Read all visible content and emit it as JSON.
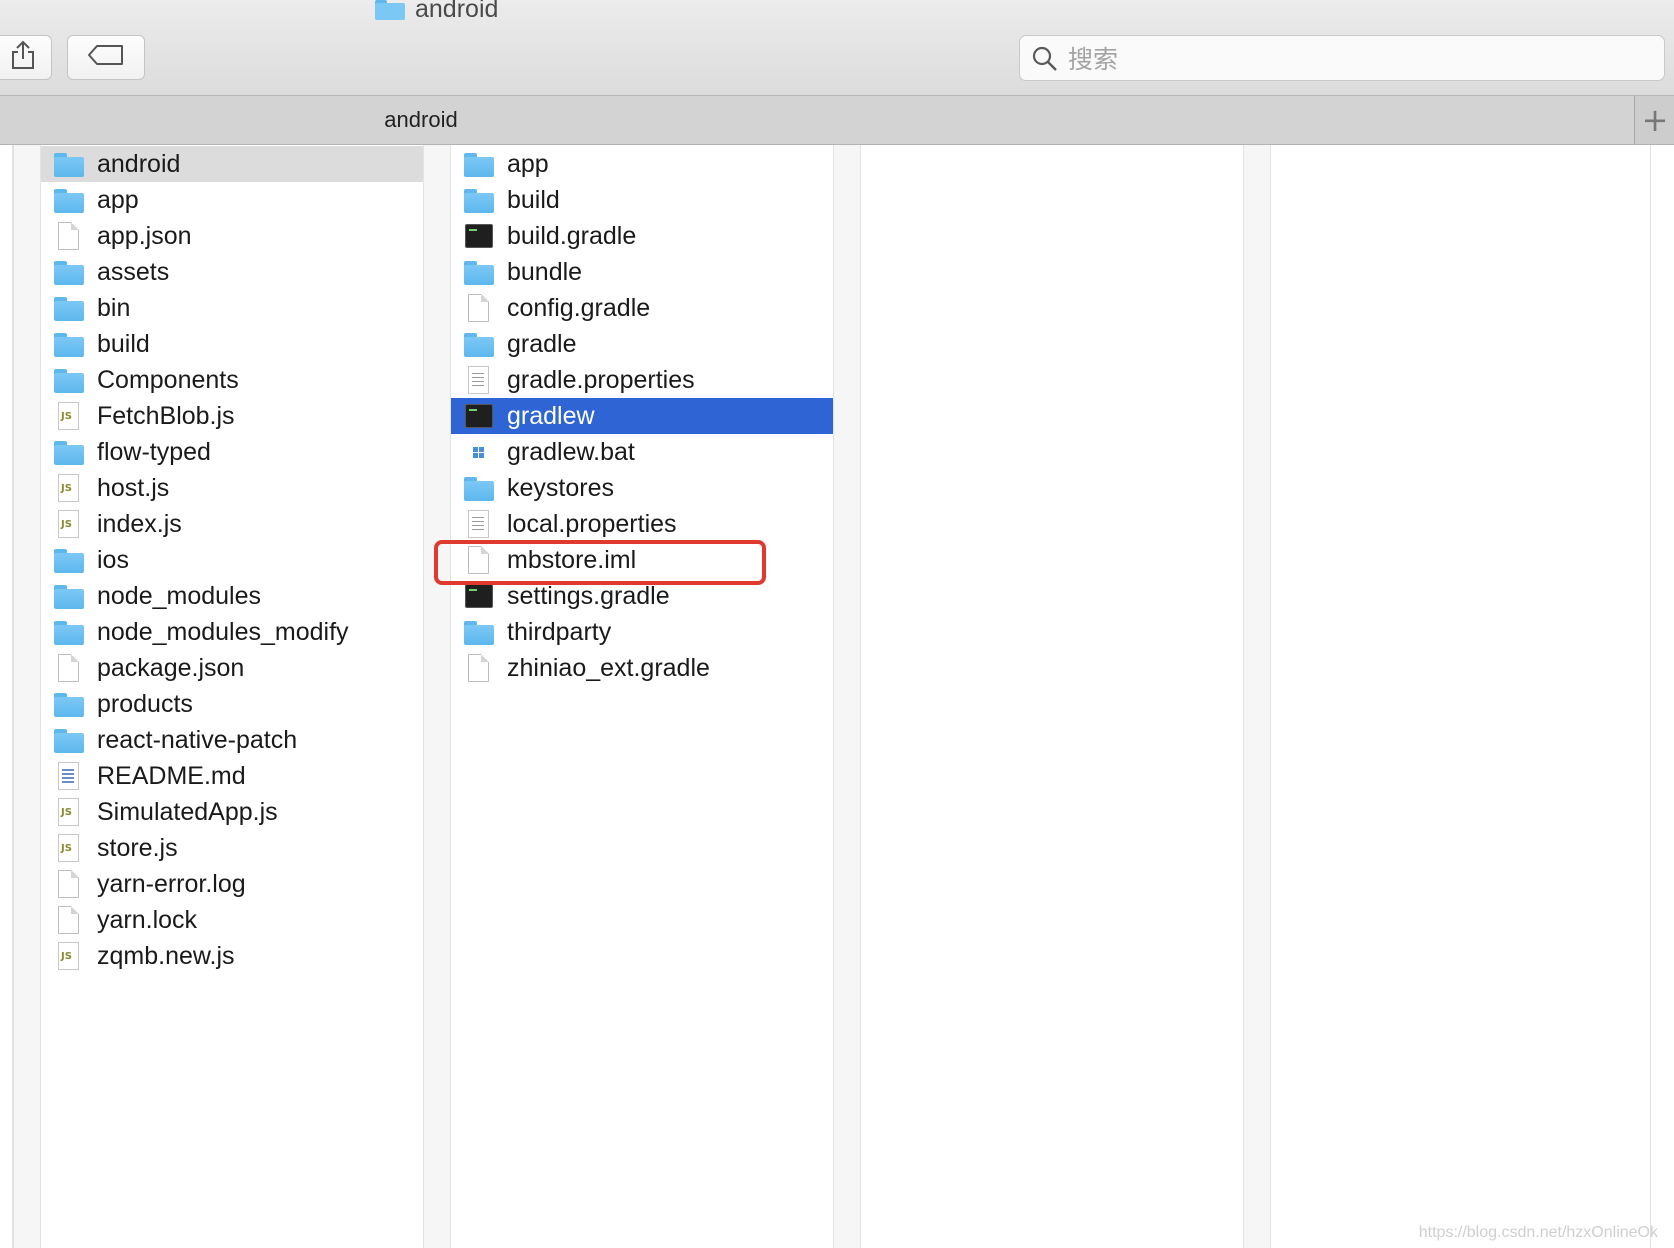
{
  "window": {
    "title": "android"
  },
  "toolbar": {
    "share_label": "",
    "tag_label": ""
  },
  "search": {
    "placeholder": "搜索",
    "value": ""
  },
  "pathbar": {
    "active_tab": "android",
    "new_tab": "+"
  },
  "colors": {
    "selection_blue": "#2e64d4",
    "highlight_red": "#e03a2f",
    "folder_blue": "#5eb8ee"
  },
  "column_parent": {
    "items": [
      {
        "name": "android",
        "icon": "folder-icon",
        "has_children": true,
        "state": "selected"
      },
      {
        "name": "app",
        "icon": "folder-icon",
        "has_children": true
      },
      {
        "name": "app.json",
        "icon": "document-icon",
        "has_children": false
      },
      {
        "name": "assets",
        "icon": "folder-icon",
        "has_children": true
      },
      {
        "name": "bin",
        "icon": "folder-icon",
        "has_children": true
      },
      {
        "name": "build",
        "icon": "folder-icon",
        "has_children": true
      },
      {
        "name": "Components",
        "icon": "folder-icon",
        "has_children": true
      },
      {
        "name": "FetchBlob.js",
        "icon": "js-file-icon",
        "has_children": false
      },
      {
        "name": "flow-typed",
        "icon": "folder-icon",
        "has_children": true
      },
      {
        "name": "host.js",
        "icon": "js-file-icon",
        "has_children": false
      },
      {
        "name": "index.js",
        "icon": "js-file-icon",
        "has_children": false
      },
      {
        "name": "ios",
        "icon": "folder-icon",
        "has_children": true
      },
      {
        "name": "node_modules",
        "icon": "folder-icon",
        "has_children": true
      },
      {
        "name": "node_modules_modify",
        "icon": "folder-icon",
        "has_children": true
      },
      {
        "name": "package.json",
        "icon": "document-icon",
        "has_children": false
      },
      {
        "name": "products",
        "icon": "folder-icon",
        "has_children": true
      },
      {
        "name": "react-native-patch",
        "icon": "folder-icon",
        "has_children": true
      },
      {
        "name": "README.md",
        "icon": "markdown-file-icon",
        "has_children": false
      },
      {
        "name": "SimulatedApp.js",
        "icon": "js-file-icon",
        "has_children": false
      },
      {
        "name": "store.js",
        "icon": "js-file-icon",
        "has_children": false
      },
      {
        "name": "yarn-error.log",
        "icon": "document-icon",
        "has_children": false
      },
      {
        "name": "yarn.lock",
        "icon": "document-icon",
        "has_children": false
      },
      {
        "name": "zqmb.new.js",
        "icon": "js-file-icon",
        "has_children": false
      }
    ]
  },
  "column_android": {
    "items": [
      {
        "name": "app",
        "icon": "folder-icon",
        "has_children": true
      },
      {
        "name": "build",
        "icon": "folder-icon",
        "has_children": true
      },
      {
        "name": "build.gradle",
        "icon": "terminal-icon",
        "has_children": false
      },
      {
        "name": "bundle",
        "icon": "folder-icon",
        "has_children": true
      },
      {
        "name": "config.gradle",
        "icon": "document-icon",
        "has_children": false
      },
      {
        "name": "gradle",
        "icon": "folder-icon",
        "has_children": true
      },
      {
        "name": "gradle.properties",
        "icon": "text-file-icon",
        "has_children": false
      },
      {
        "name": "gradlew",
        "icon": "terminal-icon",
        "has_children": false,
        "state": "active-selected"
      },
      {
        "name": "gradlew.bat",
        "icon": "windows-bat-icon",
        "has_children": false
      },
      {
        "name": "keystores",
        "icon": "folder-icon",
        "has_children": true
      },
      {
        "name": "local.properties",
        "icon": "text-file-icon",
        "has_children": false
      },
      {
        "name": "mbstore.iml",
        "icon": "document-icon",
        "has_children": false
      },
      {
        "name": "settings.gradle",
        "icon": "terminal-icon",
        "has_children": false
      },
      {
        "name": "thirdparty",
        "icon": "folder-icon",
        "has_children": true
      },
      {
        "name": "zhiniao_ext.gradle",
        "icon": "document-icon",
        "has_children": false
      }
    ]
  },
  "watermark": "https://blog.csdn.net/hzxOnlineOk"
}
